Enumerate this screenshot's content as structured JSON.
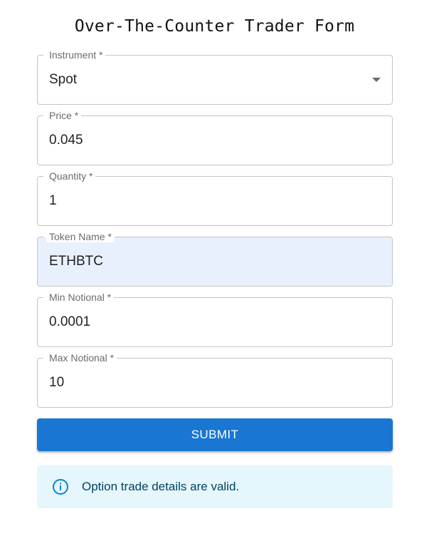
{
  "form": {
    "title": "Over-The-Counter Trader Form",
    "fields": [
      {
        "label": "Instrument *",
        "value": "Spot"
      },
      {
        "label": "Price *",
        "value": "0.045"
      },
      {
        "label": "Quantity *",
        "value": "1"
      },
      {
        "label": "Token Name *",
        "value": "ETHBTC"
      },
      {
        "label": "Min Notional *",
        "value": "0.0001"
      },
      {
        "label": "Max Notional *",
        "value": "10"
      }
    ],
    "submit_label": "SUBMIT"
  },
  "alert": {
    "message": "Option trade details are valid.",
    "icon": "info-icon"
  },
  "colors": {
    "primary": "#1976d2",
    "alert_bg": "#e5f6fd",
    "alert_text": "#014361",
    "autofill_bg": "#e8f0fe"
  }
}
